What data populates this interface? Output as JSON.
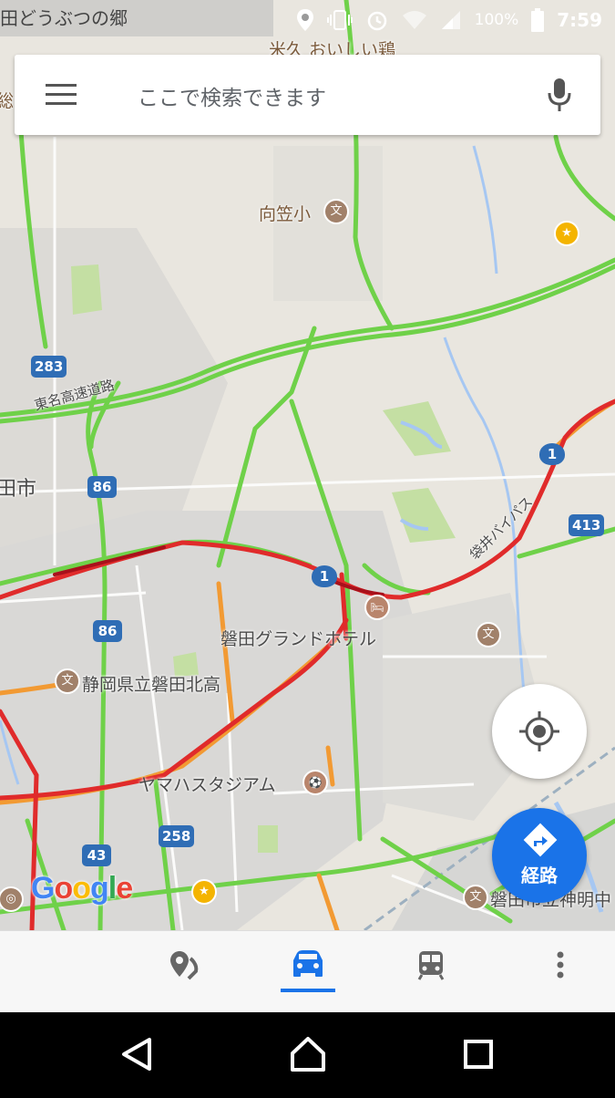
{
  "status_bar": {
    "left_text": "田どうぶつの郷",
    "battery": "100%",
    "time": "7:59"
  },
  "search": {
    "placeholder": "ここで検索できます"
  },
  "map": {
    "labels": {
      "yonekyu": "米久 おいしい鶏",
      "mukasa": "向笠小",
      "tomei": "東名高速道路",
      "city": "田市",
      "grand_hotel": "磐田グランドホテル",
      "kitako": "静岡県立磐田北高",
      "yamaha": "ヤマハスタジアム",
      "fukuroi_bypass": "袋井バイパス",
      "shinmei": "磐田市立神明中",
      "left_edge": "総合"
    },
    "route_shields": {
      "r283": "283",
      "r86a": "86",
      "r86b": "86",
      "r1a": "1",
      "r1b": "1",
      "r413": "413",
      "r258": "258",
      "r43": "43"
    },
    "poi_glyphs": {
      "school": "文",
      "hotel": "🛏",
      "stadium": "⚽",
      "star": "★"
    },
    "colors": {
      "traffic_green": "#6fd149",
      "traffic_orange": "#f29a33",
      "traffic_red": "#e02b2b",
      "traffic_dark_red": "#a8111b",
      "water": "#a6c7f2",
      "park": "#c4dfa3",
      "shield_blue": "#2f6db5",
      "accent_blue": "#1a73e8"
    }
  },
  "buttons": {
    "route_label": "経路"
  },
  "google_logo": {
    "G": "G",
    "o1": "o",
    "o2": "o",
    "g": "g",
    "l": "l",
    "e": "e"
  },
  "bottom_tabs": {
    "explore": "explore-icon",
    "driving": "car-icon",
    "transit": "train-icon",
    "more": "more-vert-icon",
    "active": "driving"
  }
}
